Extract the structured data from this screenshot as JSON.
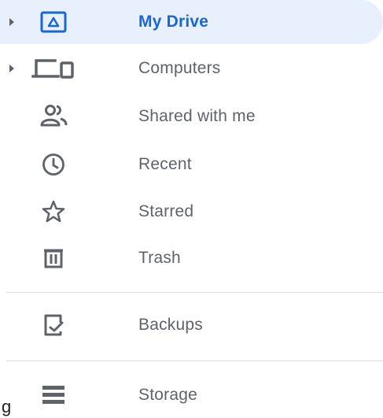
{
  "sidebar": {
    "items": [
      {
        "label": "My Drive",
        "icon": "my-drive-icon",
        "active": true,
        "expandable": true
      },
      {
        "label": "Computers",
        "icon": "computers-icon",
        "active": false,
        "expandable": true
      },
      {
        "label": "Shared with me",
        "icon": "shared-with-me-icon",
        "active": false,
        "expandable": false
      },
      {
        "label": "Recent",
        "icon": "clock-icon",
        "active": false,
        "expandable": false
      },
      {
        "label": "Starred",
        "icon": "star-icon",
        "active": false,
        "expandable": false
      },
      {
        "label": "Trash",
        "icon": "trash-icon",
        "active": false,
        "expandable": false
      },
      {
        "label": "Backups",
        "icon": "backups-icon",
        "active": false,
        "expandable": false
      },
      {
        "label": "Storage",
        "icon": "storage-icon",
        "active": false,
        "expandable": false
      }
    ],
    "clipped_text": "g"
  },
  "colors": {
    "active_text": "#1967d2",
    "active_background": "#e8f0fe",
    "text": "#5f6368",
    "icon": "#5f6368",
    "divider": "#dadce0"
  }
}
